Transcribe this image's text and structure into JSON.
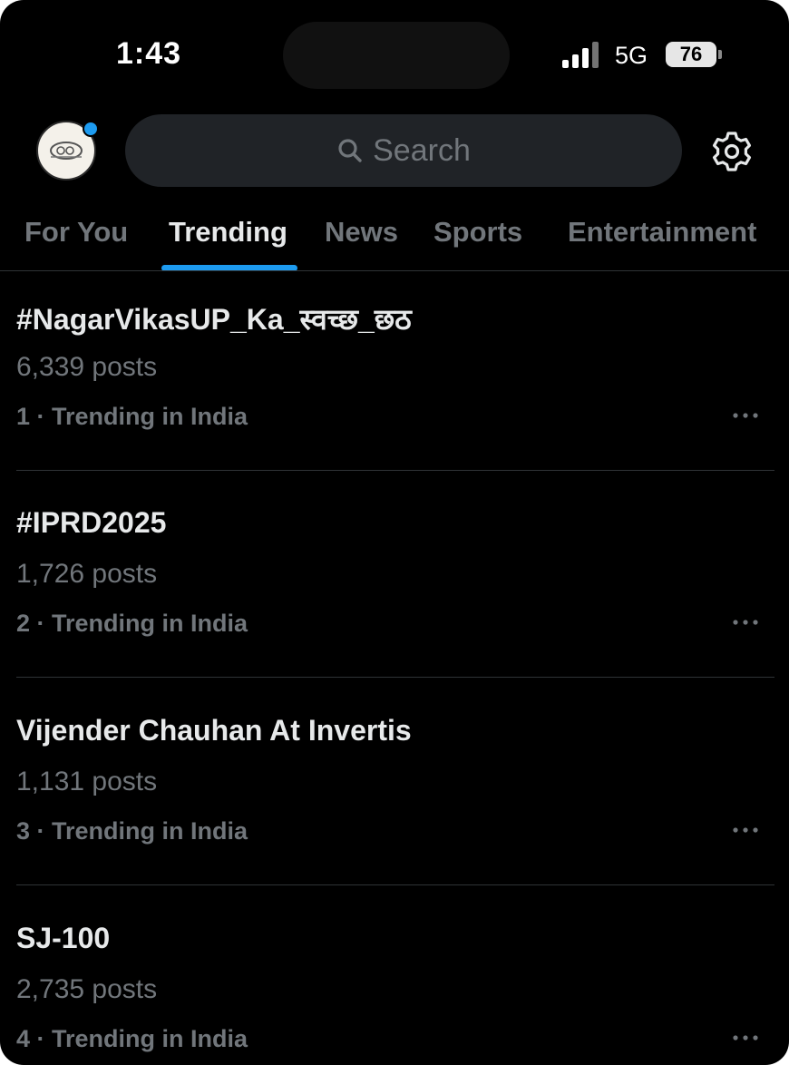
{
  "status_bar": {
    "time": "1:43",
    "network": "5G",
    "battery": "76"
  },
  "header": {
    "search_placeholder": "Search"
  },
  "tabs": [
    {
      "label": "For You"
    },
    {
      "label": "Trending"
    },
    {
      "label": "News"
    },
    {
      "label": "Sports"
    },
    {
      "label": "Entertainment"
    }
  ],
  "active_tab": "Trending",
  "colors": {
    "accent": "#1d9bf0",
    "background": "#000000",
    "muted": "#71767b"
  },
  "trends": [
    {
      "title": "#NagarVikasUP_Ka_स्वच्छ_छठ",
      "posts": "6,339 posts",
      "rank": "1 · Trending in India"
    },
    {
      "title": "#IPRD2025",
      "posts": "1,726 posts",
      "rank": "2 · Trending in India"
    },
    {
      "title": "Vijender Chauhan At Invertis",
      "posts": "1,131 posts",
      "rank": "3 · Trending in India"
    },
    {
      "title": "SJ-100",
      "posts": "2,735 posts",
      "rank": "4 · Trending in India"
    }
  ]
}
